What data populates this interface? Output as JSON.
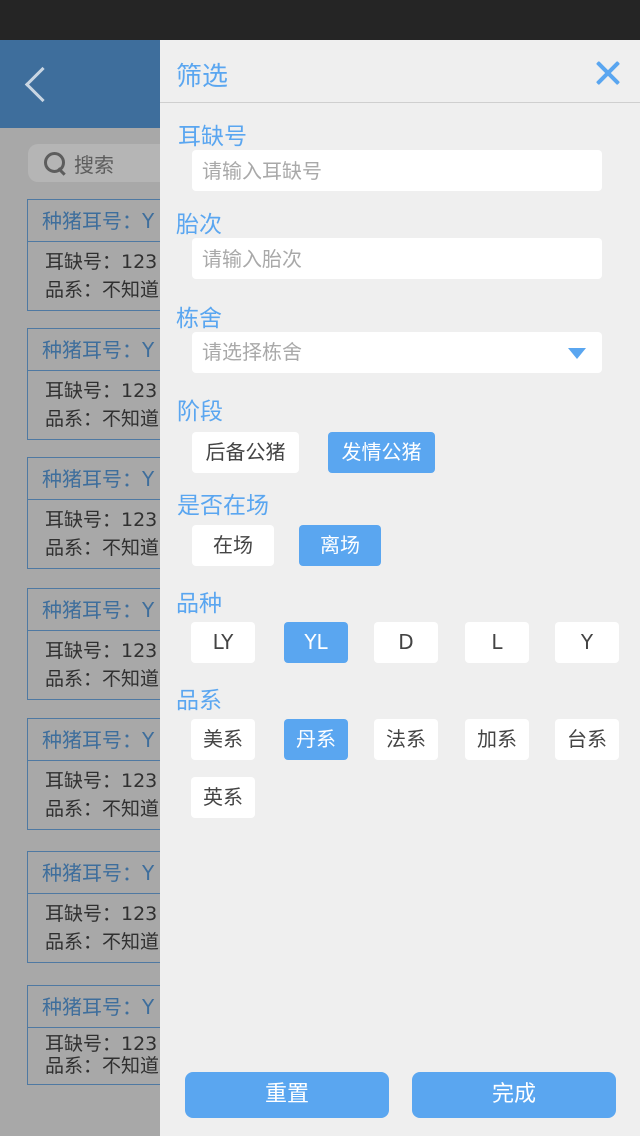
{
  "background": {
    "search_placeholder": "搜索",
    "cards": [
      {
        "title": "种猪耳号：Y",
        "line1": "耳缺号：123",
        "line2": "品系：不知道"
      },
      {
        "title": "种猪耳号：Y",
        "line1": "耳缺号：123",
        "line2": "品系：不知道"
      },
      {
        "title": "种猪耳号：Y",
        "line1": "耳缺号：123",
        "line2": "品系：不知道"
      },
      {
        "title": "种猪耳号：Y",
        "line1": "耳缺号：123",
        "line2": "品系：不知道"
      },
      {
        "title": "种猪耳号：Y",
        "line1": "耳缺号：123",
        "line2": "品系：不知道"
      },
      {
        "title": "种猪耳号：Y",
        "line1": "耳缺号：123",
        "line2": "品系：不知道"
      },
      {
        "title": "种猪耳号：Y",
        "line1": "耳缺号：123",
        "line2": "品系：不知道"
      }
    ]
  },
  "drawer": {
    "title": "筛选",
    "ear_notch": {
      "label": "耳缺号",
      "placeholder": "请输入耳缺号"
    },
    "parity": {
      "label": "胎次",
      "placeholder": "请输入胎次"
    },
    "barn": {
      "label": "栋舍",
      "placeholder": "请选择栋舍"
    },
    "stage": {
      "label": "阶段",
      "options": [
        "后备公猪",
        "发情公猪"
      ],
      "selected": "发情公猪"
    },
    "on_site": {
      "label": "是否在场",
      "options": [
        "在场",
        "离场"
      ],
      "selected": "离场"
    },
    "breed": {
      "label": "品种",
      "options": [
        "LY",
        "YL",
        "D",
        "L",
        "Y"
      ],
      "selected": "YL"
    },
    "line": {
      "label": "品系",
      "options": [
        "美系",
        "丹系",
        "法系",
        "加系",
        "台系",
        "英系"
      ],
      "selected": "丹系"
    },
    "reset_label": "重置",
    "done_label": "完成"
  },
  "colors": {
    "accent": "#5aa6f0",
    "header_dim": "#3e6e9c",
    "status_bar": "#252525"
  }
}
